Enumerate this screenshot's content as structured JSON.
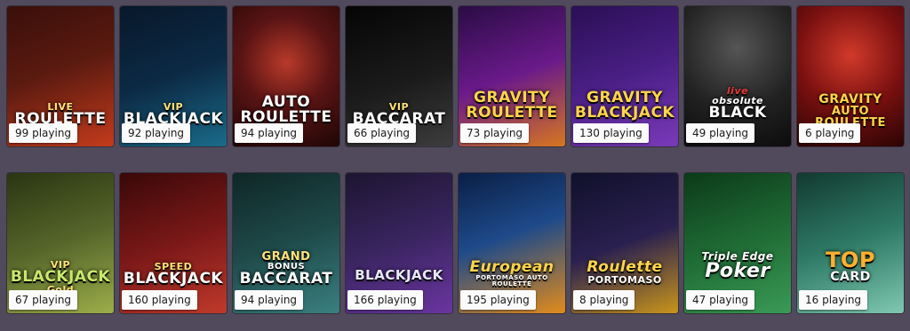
{
  "games": [
    {
      "title_top": "LIVE",
      "title_main": "ROULETTE",
      "playing": "99 playing",
      "bg1": "#5a1a10",
      "bg2": "#c43b1c"
    },
    {
      "title_top": "VIP",
      "title_main": "BLACKJACK",
      "playing": "92 playing",
      "bg1": "#0c2a45",
      "bg2": "#1a6c8a"
    },
    {
      "title_top": "AUTO",
      "title_main": "ROULETTE",
      "playing": "94 playing",
      "bg1": "#3b0c0c",
      "bg2": "#8a1f1f"
    },
    {
      "title_top": "VIP",
      "title_main": "BACCARAT",
      "playing": "66 playing",
      "bg1": "#0b0b0b",
      "bg2": "#2c2c2c"
    },
    {
      "title_top": "GRAVITY",
      "title_main": "ROULETTE",
      "playing": "73 playing",
      "bg1": "#4a1670",
      "bg2": "#c9601b"
    },
    {
      "title_top": "GRAVITY",
      "title_main": "BLACKJACK",
      "playing": "130 playing",
      "bg1": "#3a1670",
      "bg2": "#6b2aa6"
    },
    {
      "title_top": "live",
      "title_main": "BLACK",
      "title_sub": "obsolute",
      "playing": "49 playing",
      "bg1": "#1a1a1a",
      "bg2": "#4d4d4d"
    },
    {
      "title_top": "GRAVITY",
      "title_main": "AUTO ROULETTE",
      "playing": "6 playing",
      "bg1": "#3a0505",
      "bg2": "#a61c1c"
    },
    {
      "title_top": "VIP",
      "title_main": "BLACKJACK",
      "title_sub": "Gold",
      "playing": "67 playing",
      "bg1": "#3a4a1a",
      "bg2": "#8ea03c"
    },
    {
      "title_top": "SPEED",
      "title_main": "BLACKJACK",
      "playing": "160 playing",
      "bg1": "#6b1010",
      "bg2": "#c0392b"
    },
    {
      "title_top": "GRAND",
      "title_main": "BACCARAT",
      "title_sub": "BONUS",
      "playing": "94 playing",
      "bg1": "#1a3a3a",
      "bg2": "#2d6b6b"
    },
    {
      "title_top": "",
      "title_main": "BLACKJACK",
      "playing": "166 playing",
      "bg1": "#2a1f4a",
      "bg2": "#5a2a8a"
    },
    {
      "title_top": "European",
      "title_main": "",
      "title_sub": "PORTOMASO AUTO ROULETTE",
      "playing": "195 playing",
      "bg1": "#0c2a5a",
      "bg2": "#e38b1a"
    },
    {
      "title_top": "Roulette",
      "title_main": "PORTOMASO",
      "playing": "8 playing",
      "bg1": "#1a1a3a",
      "bg2": "#d4a017"
    },
    {
      "title_top": "Triple Edge Poker",
      "title_main": "Poker",
      "title_sub": "Triple Edge",
      "playing": "47 playing",
      "bg1": "#134d22",
      "bg2": "#2e8b46"
    },
    {
      "title_top": "",
      "title_main": "TOP",
      "title_sub": "CARD",
      "playing": "16 playing",
      "bg1": "#1f5a4a",
      "bg2": "#5fb39a"
    }
  ]
}
